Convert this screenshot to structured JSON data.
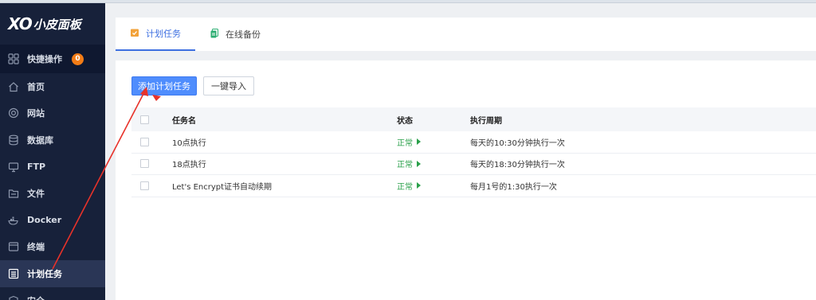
{
  "app": {
    "logo_mark": "XO",
    "logo_text": "小皮面板"
  },
  "sidebar": {
    "items": [
      {
        "label": "快捷操作",
        "icon": "grid-icon",
        "badge": "0"
      },
      {
        "label": "首页",
        "icon": "home-icon"
      },
      {
        "label": "网站",
        "icon": "globe-icon"
      },
      {
        "label": "数据库",
        "icon": "database-icon"
      },
      {
        "label": "FTP",
        "icon": "monitor-icon"
      },
      {
        "label": "文件",
        "icon": "folder-icon"
      },
      {
        "label": "Docker",
        "icon": "docker-icon"
      },
      {
        "label": "终端",
        "icon": "terminal-icon"
      },
      {
        "label": "计划任务",
        "icon": "task-list-icon",
        "active": true
      },
      {
        "label": "安全",
        "icon": "shield-icon"
      }
    ]
  },
  "tabs": [
    {
      "label": "计划任务",
      "icon": "calendar-check-icon",
      "active": true
    },
    {
      "label": "在线备份",
      "icon": "backup-icon"
    }
  ],
  "toolbar": {
    "add_label": "添加计划任务",
    "import_label": "一键导入"
  },
  "table": {
    "columns": [
      "任务名",
      "状态",
      "执行周期"
    ],
    "rows": [
      {
        "name": "10点执行",
        "status": "正常",
        "cycle": "每天的10:30分钟执行一次"
      },
      {
        "name": "18点执行",
        "status": "正常",
        "cycle": "每天的18:30分钟执行一次"
      },
      {
        "name": "Let's Encrypt证书自动续期",
        "status": "正常",
        "cycle": "每月1号的1:30执行一次"
      }
    ]
  },
  "colors": {
    "sidebar_bg": "#17213a",
    "accent": "#3d6fe0",
    "primary_button": "#4f8dfd",
    "status_ok": "#2aa04a",
    "badge": "#f27c16",
    "annotation": "#e8322a"
  }
}
